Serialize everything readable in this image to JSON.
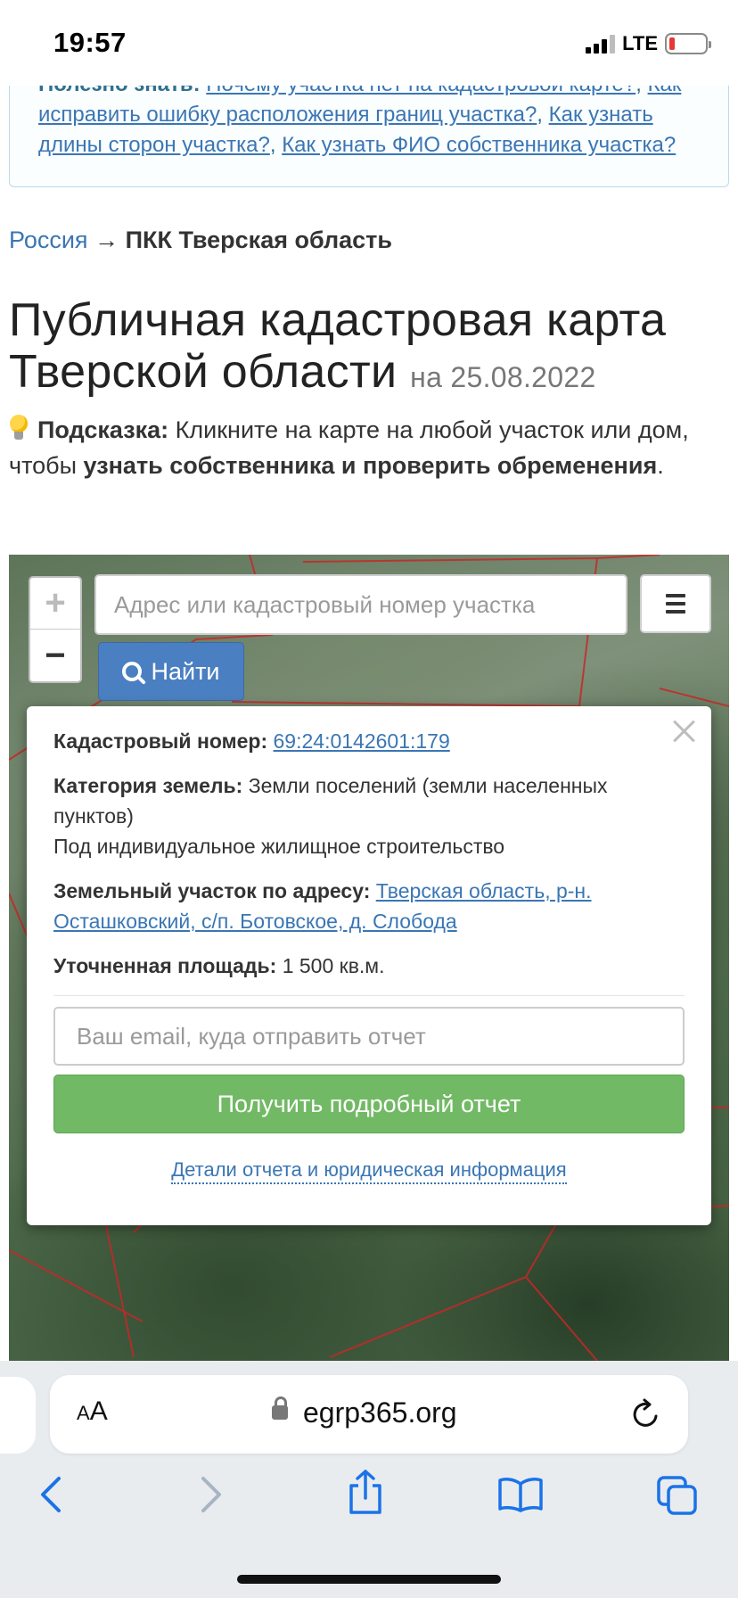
{
  "status": {
    "time": "19:57",
    "network": "LTE"
  },
  "tip_box": {
    "label": "Полезно знать:",
    "links": [
      "Почему участка нет на кадастровой карте?",
      "Как исправить ошибку расположения границ участка?",
      "Как узнать длины сторон участка?",
      "Как узнать ФИО собственника участка?"
    ]
  },
  "breadcrumb": {
    "root": "Россия",
    "separator": "→",
    "current": "ПКК Тверская область"
  },
  "page": {
    "title": "Публичная кадастровая карта Тверской области",
    "date": "на 25.08.2022"
  },
  "hint": {
    "label": "Подсказка:",
    "text_1": "Кликните на карте на любой участок или дом, чтобы",
    "bold": "узнать собственника и проверить обременения",
    "end": "."
  },
  "map": {
    "zoom_in": "+",
    "zoom_out": "−",
    "search_placeholder": "Адрес или кадастровый номер участка",
    "find_label": "Найти"
  },
  "popup": {
    "cadastral_label": "Кадастровый номер:",
    "cadastral_number": "69:24:0142601:179",
    "category_label": "Категория земель:",
    "category_value": "Земли поселений (земли населенных пунктов)",
    "usage": "Под индивидуальное жилищное строительство",
    "address_label": "Земельный участок по адресу:",
    "address_value": "Тверская область, р-н. Осташковский, с/п. Ботовское, д. Слобода",
    "area_label": "Уточненная площадь:",
    "area_value": "1 500 кв.м.",
    "email_placeholder": "Ваш email, куда отправить отчет",
    "report_button": "Получить подробный отчет",
    "details_link": "Детали отчета и юридическая информация"
  },
  "browser": {
    "aa_small": "A",
    "aa_large": "A",
    "url": "egrp365.org"
  },
  "colors": {
    "link": "#3a76b4",
    "find_button": "#4a7fc1",
    "report_button": "#72b965",
    "parcel_border": "#c62828",
    "battery_low": "#e53935"
  }
}
